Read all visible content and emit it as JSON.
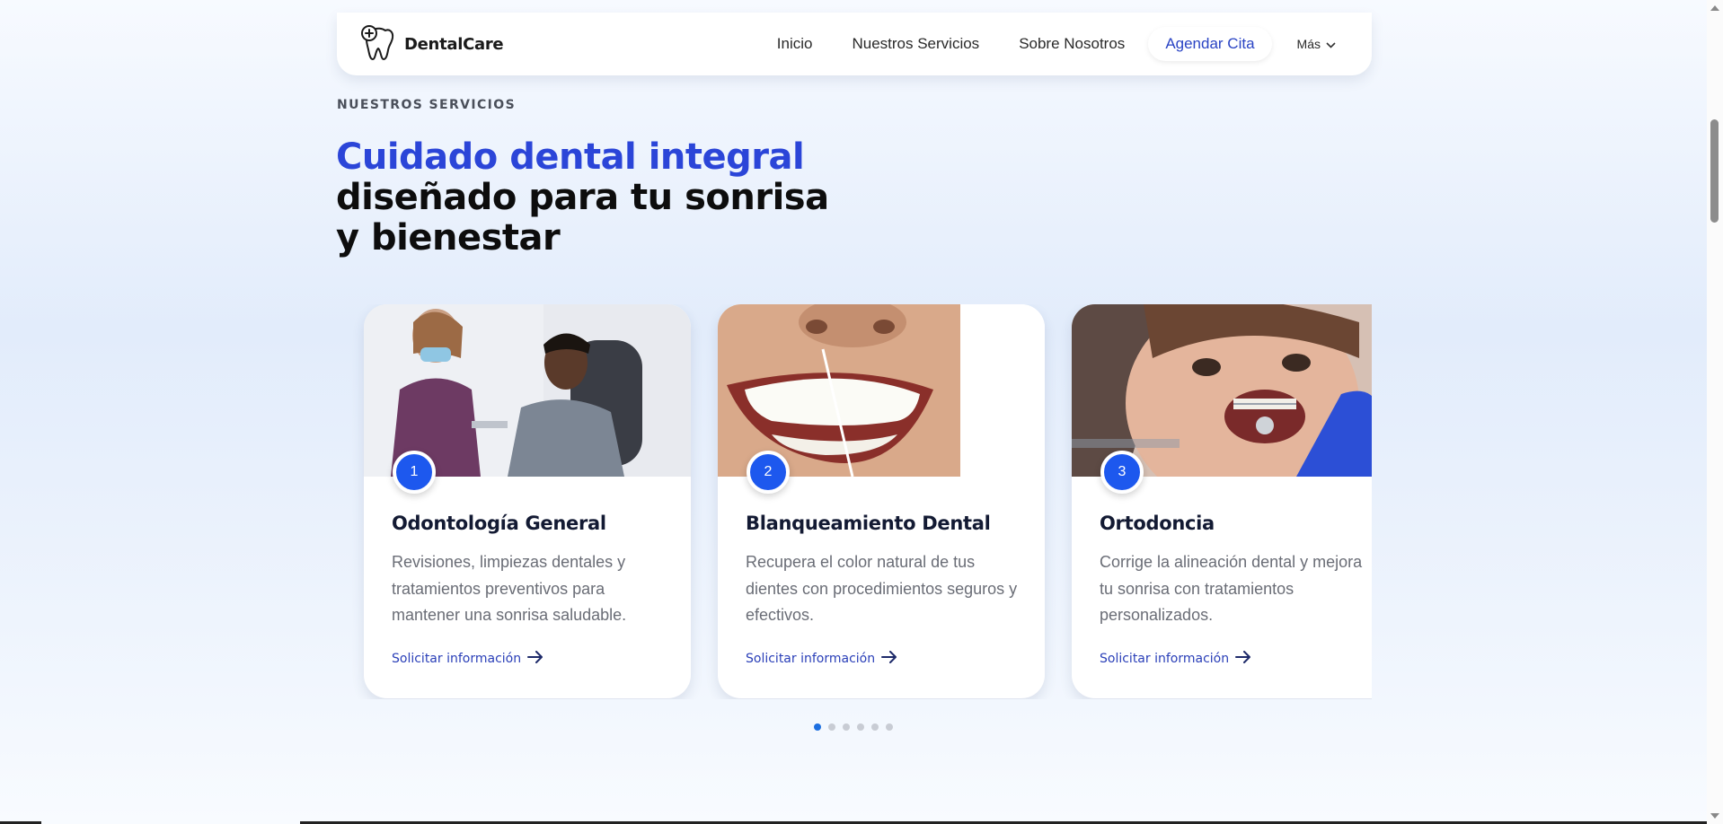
{
  "brand": {
    "name": "DentalCare"
  },
  "nav": {
    "links": [
      "Inicio",
      "Nuestros Servicios",
      "Sobre Nosotros"
    ],
    "cta_label": "Agendar Cita",
    "more_label": "Más"
  },
  "section": {
    "eyebrow": "NUESTROS SERVICIOS",
    "headline_accent": "Cuidado dental integral",
    "headline_rest": "diseñado para tu sonrisa y bienestar"
  },
  "cards": [
    {
      "number": "1",
      "title": "Odontología General",
      "description": "Revisiones, limpiezas dentales y tratamientos preventivos para mantener una sonrisa saludable.",
      "link_label": "Solicitar información"
    },
    {
      "number": "2",
      "title": "Blanqueamiento Dental",
      "description": "Recupera el color natural de tus dientes con procedimientos seguros y efectivos.",
      "link_label": "Solicitar información"
    },
    {
      "number": "3",
      "title": "Ortodoncia",
      "description": "Corrige la alineación dental y mejora tu sonrisa con tratamientos personalizados.",
      "link_label": "Solicitar información"
    }
  ],
  "carousel": {
    "total_pages": 6,
    "active_page": 1
  },
  "colors": {
    "accent": "#2b45d8",
    "number_badge": "#1d58ee",
    "link": "#2a3fb8",
    "active_dot": "#1d6fe0"
  }
}
